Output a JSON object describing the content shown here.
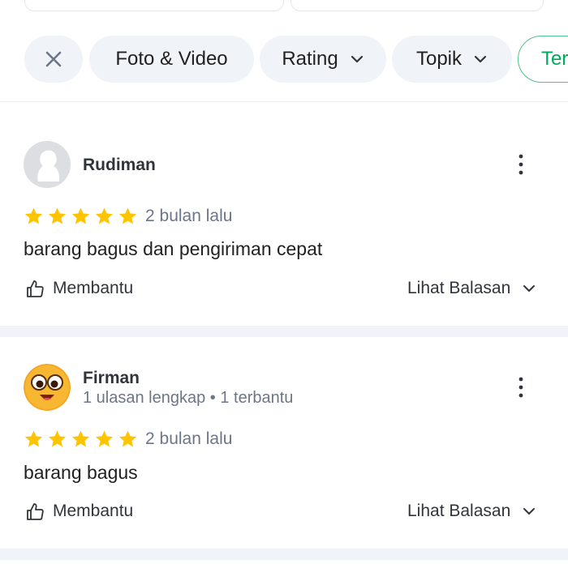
{
  "filters": {
    "close_icon": "close-icon",
    "chips": [
      {
        "label": "Foto & Video"
      },
      {
        "label": "Rating"
      },
      {
        "label": "Topik"
      },
      {
        "label": "Ter"
      }
    ]
  },
  "colors": {
    "star": "#ffc400",
    "accent": "#00aa5b",
    "chip_bg": "#f0f3f7"
  },
  "reviews": [
    {
      "name": "Rudiman",
      "meta": "",
      "rating": 5,
      "time": "2 bulan lalu",
      "text": "barang bagus dan pengiriman cepat",
      "helpful_label": "Membantu",
      "replies_label": "Lihat Balasan",
      "avatar_icon": "default-avatar-icon"
    },
    {
      "name": "Firman",
      "meta": "1 ulasan lengkap • 1 terbantu",
      "rating": 5,
      "time": "2 bulan lalu",
      "text": "barang bagus",
      "helpful_label": "Membantu",
      "replies_label": "Lihat Balasan",
      "avatar_icon": "emoji-avatar-icon"
    }
  ]
}
